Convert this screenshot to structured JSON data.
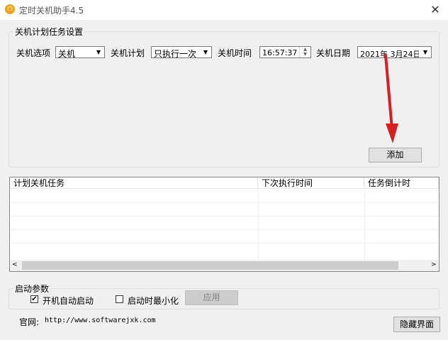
{
  "window": {
    "title": "定时关机助手4.5",
    "close_glyph": "✕"
  },
  "settings": {
    "group_title": "关机计划任务设置",
    "option_label": "关机选项",
    "option_value": "关机",
    "plan_label": "关机计划",
    "plan_value": "只执行一次",
    "time_label": "关机时间",
    "time_value": "16:57:37",
    "date_label": "关机日期",
    "date_value": "2021年 3月24日",
    "add_button": "添加"
  },
  "task_list": {
    "columns": [
      "计划关机任务",
      "下次执行时间",
      "任务倒计时"
    ],
    "rows": []
  },
  "startup": {
    "group_title": "启动参数",
    "autostart_label": "开机自动启动",
    "autostart_checked": true,
    "minimize_label": "启动时最小化",
    "minimize_checked": false,
    "apply_button": "应用"
  },
  "footer": {
    "website_label": "官网:",
    "website_url": "http://www.softwarejxk.com",
    "hide_button": "隐藏界面"
  },
  "icons": {
    "dropdown": "dropdown-arrow-icon",
    "spin_up": "spin-up-icon",
    "spin_down": "spin-down-icon",
    "scroll_left": "scroll-left-icon",
    "scroll_right": "scroll-right-icon",
    "check": "checkmark-icon"
  },
  "colors": {
    "window_bg": "#f0f0f0",
    "app_icon": "#f2a31b",
    "button_bg": "#e1e1e1",
    "button_border": "#adadad",
    "annotation_arrow": "#d42020"
  }
}
